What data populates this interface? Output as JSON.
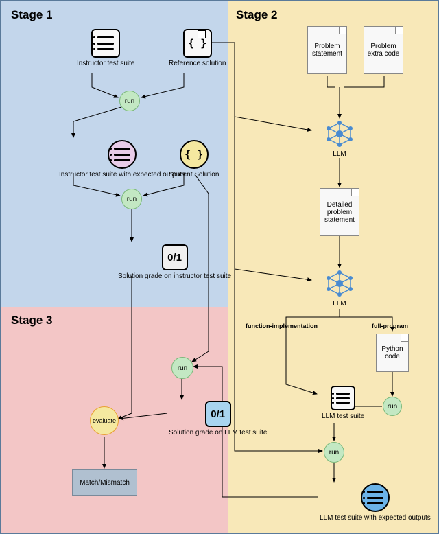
{
  "stages": {
    "s1": "Stage 1",
    "s2": "Stage 2",
    "s3": "Stage 3"
  },
  "nodes": {
    "instructor_suite": "Instructor\ntest suite",
    "reference_solution": "Reference\nsolution",
    "run": "run",
    "instructor_expected": "Instructor test suite\nwith expected outputs",
    "student_solution": "Student Solution",
    "grade_instructor_label": "Solution grade on\ninstructor test suite",
    "grade_value": "0/1",
    "problem_statement": "Problem\nstatement",
    "problem_extra": "Problem\nextra code",
    "llm": "LLM",
    "detailed_problem": "Detailed\nproblem\nstatement",
    "branch_func": "function-implementation",
    "branch_full": "full-program",
    "python_code": "Python\ncode",
    "llm_suite": "LLM test\nsuite",
    "llm_suite_expected": "LLM test suite with\nexpected outputs",
    "evaluate": "evaluate",
    "grade_llm_label": "Solution grade on LLM\ntest suite",
    "match": "Match/Mismatch"
  }
}
